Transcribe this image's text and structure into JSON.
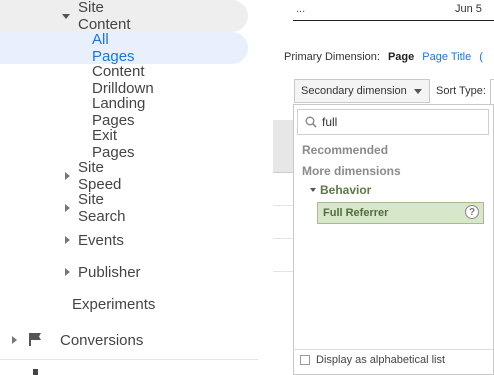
{
  "sidebar": {
    "items": [
      {
        "label": "Site Content",
        "indent": 1,
        "expanded": true,
        "caret": "down"
      },
      {
        "label": "All Pages",
        "indent": 2,
        "selected": true
      },
      {
        "label": "Content Drilldown",
        "indent": 2
      },
      {
        "label": "Landing Pages",
        "indent": 2
      },
      {
        "label": "Exit Pages",
        "indent": 2
      },
      {
        "label": "Site Speed",
        "indent": 1,
        "caret": "right"
      },
      {
        "label": "Site Search",
        "indent": 1,
        "caret": "right"
      },
      {
        "label": "Events",
        "indent": 1,
        "caret": "right"
      },
      {
        "label": "Publisher",
        "indent": 1,
        "caret": "right"
      },
      {
        "label": "Experiments",
        "indent": 1
      },
      {
        "label": "Conversions",
        "indent": 0,
        "caret": "right",
        "icon": "flag-icon"
      }
    ]
  },
  "header": {
    "ellipsis": "...",
    "date": "Jun 5"
  },
  "primary_dimension": {
    "label": "Primary Dimension:",
    "active": "Page",
    "other": "Page Title",
    "cut_off": "("
  },
  "toolbar": {
    "secondary_dimension": "Secondary dimension",
    "sort_type_label": "Sort Type:"
  },
  "dropdown": {
    "search_value": "full",
    "recommended": "Recommended",
    "more_dimensions": "More dimensions",
    "group": "Behavior",
    "item": "Full Referrer",
    "help": "?",
    "alphabetical": "Display as alphabetical list"
  },
  "colors": {
    "selected_bg": "#e8f0fe",
    "selected_text": "#1a73e8",
    "expanded_bg": "#eeeeee",
    "link": "#1a73e8",
    "match_bg": "#d8e6c9",
    "match_text": "#4f6d3c"
  }
}
